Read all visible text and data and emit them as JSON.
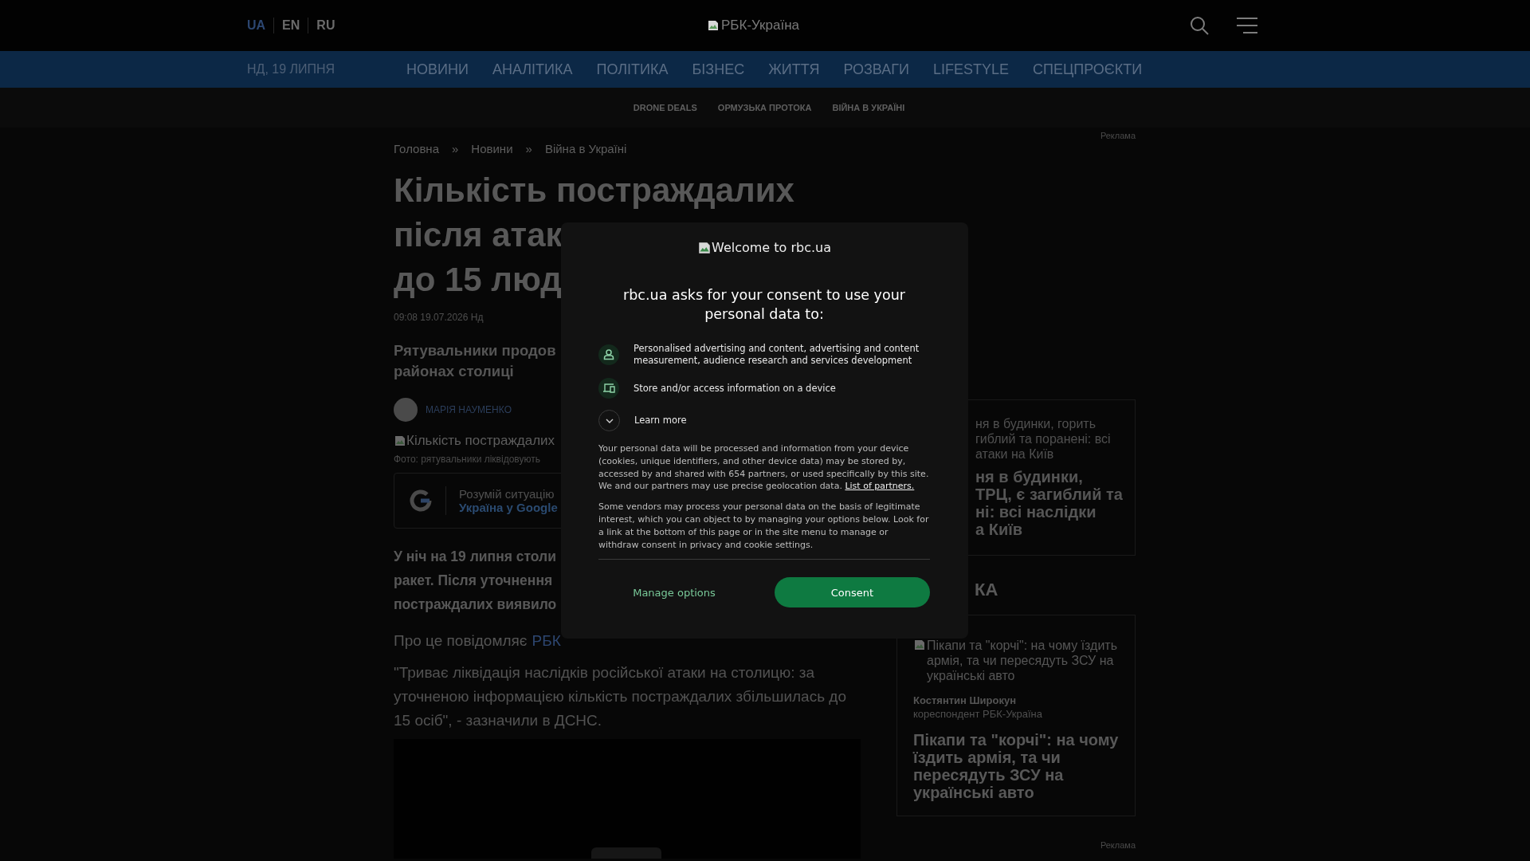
{
  "header": {
    "languages": [
      {
        "label": "UA",
        "selected": true
      },
      {
        "label": "EN",
        "selected": false
      },
      {
        "label": "RU",
        "selected": false
      }
    ],
    "logo_alt": "РБК-Україна"
  },
  "nav": {
    "date": "НД, 19 ЛИПНЯ",
    "items": [
      "НОВИНИ",
      "АНАЛІТИКА",
      "ПОЛІТИКА",
      "БІЗНЕС",
      "ЖИТТЯ",
      "РОЗВАГИ",
      "LIFESTYLE",
      "СПЕЦПРОЄКТИ"
    ]
  },
  "tags": [
    "DRONE DEALS",
    "ОРМУЗЬКА ПРОТОКА",
    "ВІЙНА В УКРАЇНІ"
  ],
  "ad_label_top": "Реклама",
  "article": {
    "breadcrumbs": [
      "Головна",
      "Новини",
      "Війна в Україні"
    ],
    "separators": [
      "»",
      "»"
    ],
    "title_lines": [
      "Кількість постраждалих",
      "після атак",
      "до 15 люд"
    ],
    "datetime": "09:08 19.07.2026 Нд",
    "lead_lines": [
      "Рятувальники продов",
      "районах столиці"
    ],
    "author": "МАРІЯ НАУМЕНКО",
    "image_alt": "Кількість постраждалих",
    "photo_caption": "Фото: рятувальники ліквідовують",
    "google_promo": {
      "text": "Розумій ситуацію",
      "link": "Україна у Google"
    },
    "bold_lines": [
      "У ніч на 19 липня столи",
      "ракет. Після уточнення",
      "постраждалих виявило"
    ],
    "source_text": "Про це повідомляє",
    "source_link": "РБК",
    "quote": "\"Триває ліквідація наслідків російської атаки на столицю: за уточненою інформацією кількість постраждалих збільшилась до 15 осіб\", - зазначили в ДСНС."
  },
  "sidebar": {
    "card1": {
      "image_alt_lines": [
        "ня в будинки, горить",
        "гиблий та поранені: всі",
        "атаки на Київ"
      ],
      "title_lines": [
        "ня в будинки,",
        "ТРЦ, є загиблий та",
        "ні: всі наслідки",
        "а Київ"
      ]
    },
    "section_heading": "КА",
    "card2": {
      "image_alt": "Пікапи та \"корчі\": на чому їздить армія, та чи пересядуть ЗСУ на українські авто",
      "author": "Костянтин Широкун",
      "role": "кореспондент РБК-Україна",
      "title": "Пікапи та \"корчі\": на чому їздить армія, та чи пересядуть ЗСУ на українські авто"
    },
    "ad_label_bottom": "Реклама"
  },
  "consent": {
    "logo_alt": "Welcome to rbc.ua",
    "heading": "rbc.ua asks for your consent to use your personal data to:",
    "purposes": [
      {
        "kind": "person",
        "text": "Personalised advertising and content, advertising and content measurement, audience research and services development"
      },
      {
        "kind": "device",
        "text": "Store and/or access information on a device"
      }
    ],
    "learn_more": "Learn more",
    "paragraph1": "Your personal data will be processed and information from your device (cookies, unique identifiers, and other device data) may be stored by, accessed by and shared with 654 partners, or used specifically by this site. We and our partners may use precise geolocation data.",
    "partners_link": "List of partners.",
    "paragraph2": "Some vendors may process your personal data on the basis of legitimate interest, which you can object to by managing your options below. Look for a link at the bottom of this page or in the site menu to manage or withdraw consent in privacy and cookie settings.",
    "manage_button": "Manage options",
    "consent_button": "Consent"
  }
}
